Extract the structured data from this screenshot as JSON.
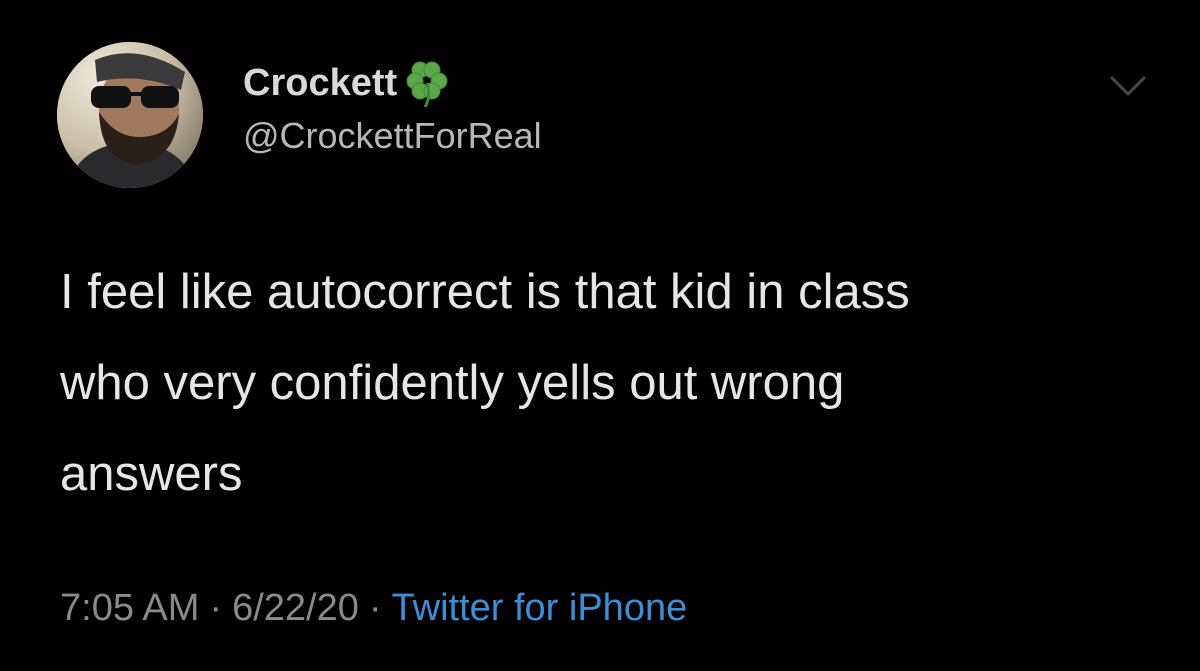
{
  "tweet": {
    "display_name": "Crockett",
    "name_emoji_icon": "four-leaf-clover-icon",
    "handle": "@CrockettForReal",
    "text": "I feel like autocorrect is that kid in class\nwho very confidently yells out wrong\nanswers",
    "time": "7:05 AM",
    "separator": "·",
    "date": "6/22/20",
    "source": "Twitter for iPhone",
    "menu_icon": "chevron-down-icon"
  },
  "colors": {
    "background": "#000000",
    "text": "#e6e6e6",
    "muted": "#8a8a8a",
    "link": "#3b8fd9",
    "clover": "#5aa84a"
  }
}
